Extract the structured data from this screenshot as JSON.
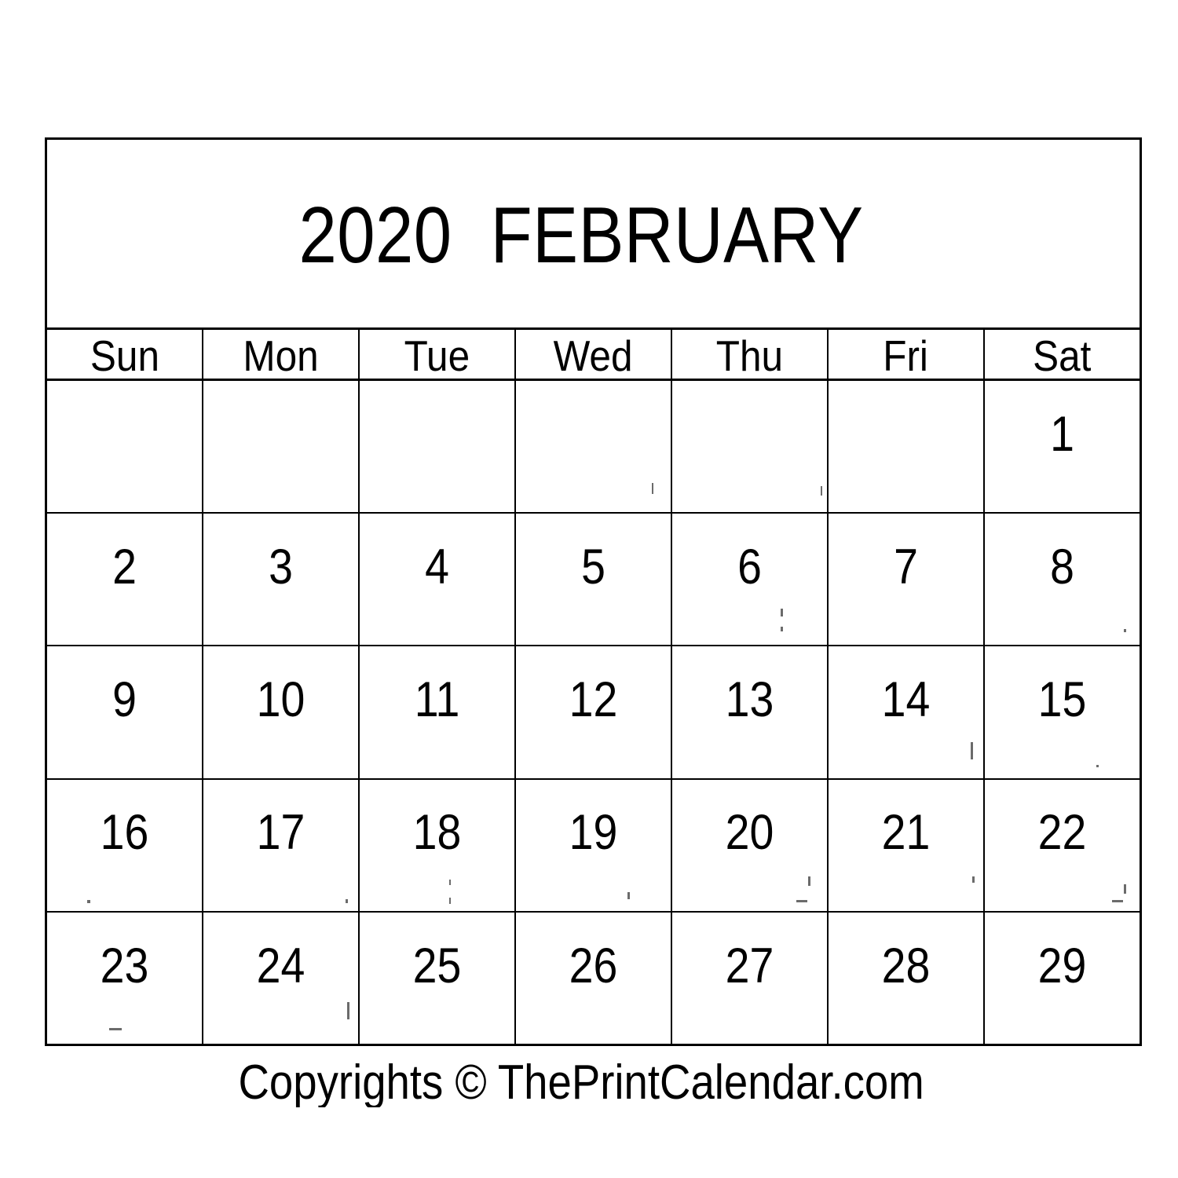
{
  "document": {
    "type": "printable-monthly-calendar",
    "title_year": "2020",
    "title_month": "FEBRUARY",
    "title_full": "2020  FEBRUARY",
    "footer": "Copyrights © ThePrintCalendar.com",
    "ink_color": "#000000",
    "paper_color": "#ffffff"
  },
  "weekdays": [
    {
      "label": "Sun"
    },
    {
      "label": "Mon"
    },
    {
      "label": "Tue"
    },
    {
      "label": "Wed"
    },
    {
      "label": "Thu"
    },
    {
      "label": "Fri"
    },
    {
      "label": "Sat"
    }
  ],
  "weeks": [
    {
      "days": [
        {
          "num": "",
          "empty": true
        },
        {
          "num": "",
          "empty": true
        },
        {
          "num": "",
          "empty": true
        },
        {
          "num": "",
          "empty": true
        },
        {
          "num": "",
          "empty": true
        },
        {
          "num": "",
          "empty": true
        },
        {
          "num": "1",
          "empty": false
        }
      ]
    },
    {
      "days": [
        {
          "num": "2",
          "empty": false
        },
        {
          "num": "3",
          "empty": false
        },
        {
          "num": "4",
          "empty": false
        },
        {
          "num": "5",
          "empty": false
        },
        {
          "num": "6",
          "empty": false
        },
        {
          "num": "7",
          "empty": false
        },
        {
          "num": "8",
          "empty": false
        }
      ]
    },
    {
      "days": [
        {
          "num": "9",
          "empty": false
        },
        {
          "num": "10",
          "empty": false
        },
        {
          "num": "11",
          "empty": false
        },
        {
          "num": "12",
          "empty": false
        },
        {
          "num": "13",
          "empty": false
        },
        {
          "num": "14",
          "empty": false
        },
        {
          "num": "15",
          "empty": false
        }
      ]
    },
    {
      "days": [
        {
          "num": "16",
          "empty": false
        },
        {
          "num": "17",
          "empty": false
        },
        {
          "num": "18",
          "empty": false
        },
        {
          "num": "19",
          "empty": false
        },
        {
          "num": "20",
          "empty": false
        },
        {
          "num": "21",
          "empty": false
        },
        {
          "num": "22",
          "empty": false
        }
      ]
    },
    {
      "days": [
        {
          "num": "23",
          "empty": false
        },
        {
          "num": "24",
          "empty": false
        },
        {
          "num": "25",
          "empty": false
        },
        {
          "num": "26",
          "empty": false
        },
        {
          "num": "27",
          "empty": false
        },
        {
          "num": "28",
          "empty": false
        },
        {
          "num": "29",
          "empty": false
        }
      ]
    }
  ]
}
